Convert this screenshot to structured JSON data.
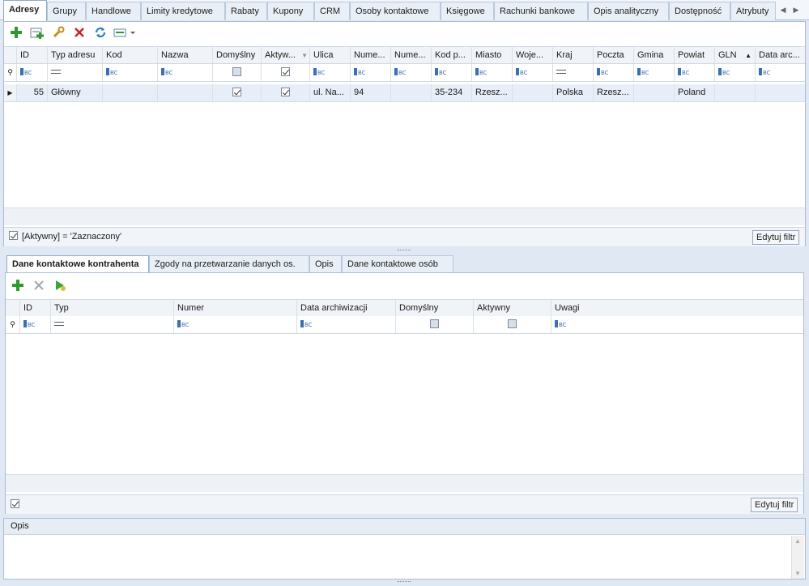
{
  "top_tabs": [
    "Adresy",
    "Grupy",
    "Handlowe",
    "Limity kredytowe",
    "Rabaty",
    "Kupony",
    "CRM",
    "Osoby kontaktowe",
    "Księgowe",
    "Rachunki bankowe",
    "Opis analityczny",
    "Dostępność",
    "Atrybuty"
  ],
  "addresses": {
    "columns": [
      "ID",
      "Typ adresu",
      "Kod",
      "Nazwa",
      "Domyślny",
      "Aktyw...",
      "Ulica",
      "Nume...",
      "Nume...",
      "Kod p...",
      "Miasto",
      "Woje...",
      "Kraj",
      "Poczta",
      "Gmina",
      "Powiat",
      "GLN",
      "Data arc..."
    ],
    "row": {
      "id": "55",
      "typ": "Główny",
      "kod": "",
      "nazwa": "",
      "ulica": "ul. Na...",
      "numer1": "94",
      "numer2": "",
      "kod_pocztowy": "35-234",
      "miasto": "Rzesz...",
      "wojewodztwo": "",
      "kraj": "Polska",
      "poczta": "Rzesz...",
      "gmina": "",
      "powiat": "Poland",
      "gln": "",
      "data": ""
    },
    "filter_text": "[Aktywny] = 'Zaznaczony'",
    "edit_filter": "Edytuj filtr"
  },
  "sub_tabs": [
    "Dane kontaktowe kontrahenta",
    "Zgody na przetwarzanie danych os.",
    "Opis",
    "Dane kontaktowe osób"
  ],
  "contacts": {
    "columns": [
      "ID",
      "Typ",
      "Numer",
      "Data archiwizacji",
      "Domyślny",
      "Aktywny",
      "Uwagi"
    ],
    "edit_filter": "Edytuj filtr"
  },
  "opis": {
    "title": "Opis"
  },
  "colors": {
    "accent": "#3a6fb5",
    "panel_border": "#a9bcd6",
    "selected_row": "#e7eef8"
  }
}
